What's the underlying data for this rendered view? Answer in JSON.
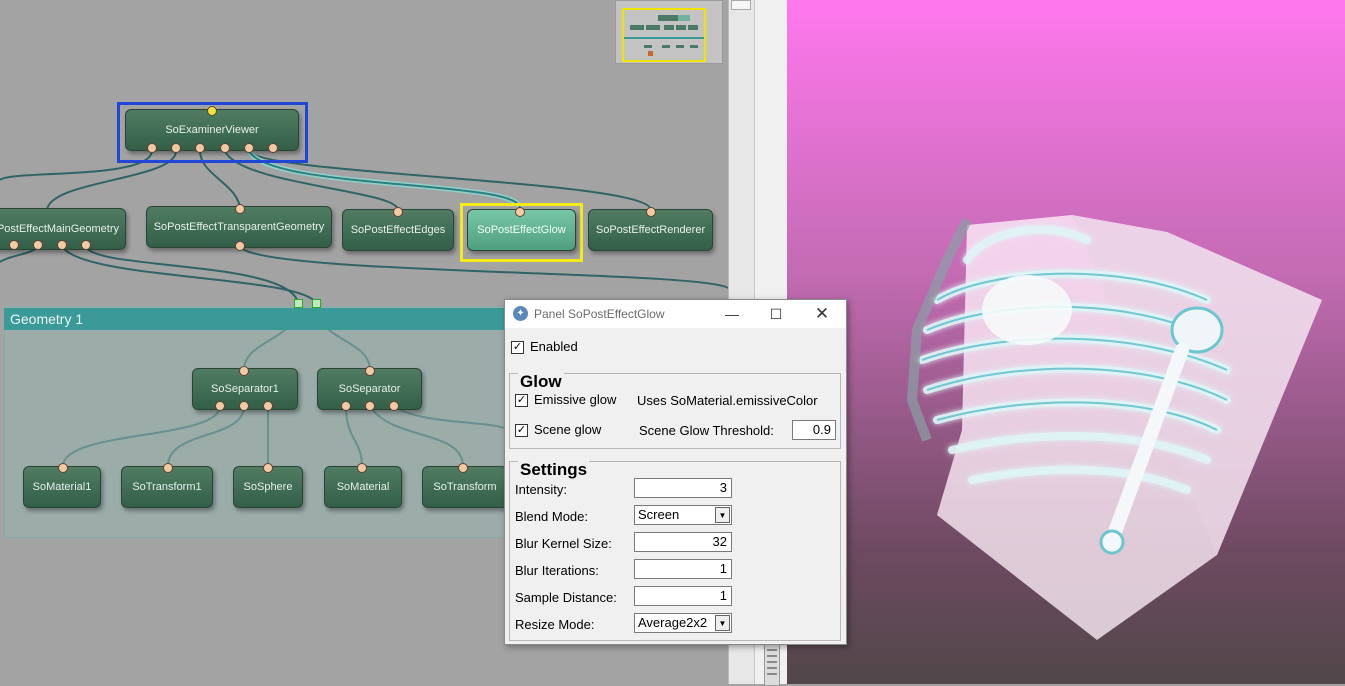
{
  "graph": {
    "nodes": {
      "examiner": "SoExaminerViewer",
      "main_geometry": "PostEffectMainGeometry",
      "transparent_geometry": "SoPostEffectTransparentGeometry",
      "edges": "SoPostEffectEdges",
      "glow": "SoPostEffectGlow",
      "renderer": "SoPostEffectRenderer",
      "separator1": "SoSeparator1",
      "separator": "SoSeparator",
      "material1": "SoMaterial1",
      "transform1": "SoTransform1",
      "sphere": "SoSphere",
      "material": "SoMaterial",
      "transform": "SoTransform"
    },
    "group_title": "Geometry 1"
  },
  "panel": {
    "title": "Panel SoPostEffectGlow",
    "enabled_label": "Enabled",
    "glow_header": "Glow",
    "emissive_glow_label": "Emissive glow",
    "emissive_note": "Uses SoMaterial.emissiveColor",
    "scene_glow_label": "Scene glow",
    "scene_glow_threshold_label": "Scene Glow Threshold:",
    "scene_glow_threshold": "0.9",
    "settings_header": "Settings",
    "intensity_label": "Intensity:",
    "intensity": "3",
    "blend_mode_label": "Blend Mode:",
    "blend_mode": "Screen",
    "blur_kernel_label": "Blur Kernel Size:",
    "blur_kernel": "32",
    "blur_iterations_label": "Blur Iterations:",
    "blur_iterations": "1",
    "sample_distance_label": "Sample Distance:",
    "sample_distance": "1",
    "resize_mode_label": "Resize Mode:",
    "resize_mode": "Average2x2",
    "checkboxes": {
      "enabled": true,
      "emissive_glow": true,
      "scene_glow": true
    }
  },
  "colors": {
    "node_active": "#5fb08e",
    "selection_blue": "#1f46d6",
    "selection_yellow": "#f2ea1a",
    "viewer_top": "#ff78ee",
    "viewer_bottom": "#514749"
  },
  "icons": {
    "panel_icon": "app-icon",
    "minimize": "minimize-icon",
    "maximize": "maximize-icon",
    "close": "close-icon"
  }
}
